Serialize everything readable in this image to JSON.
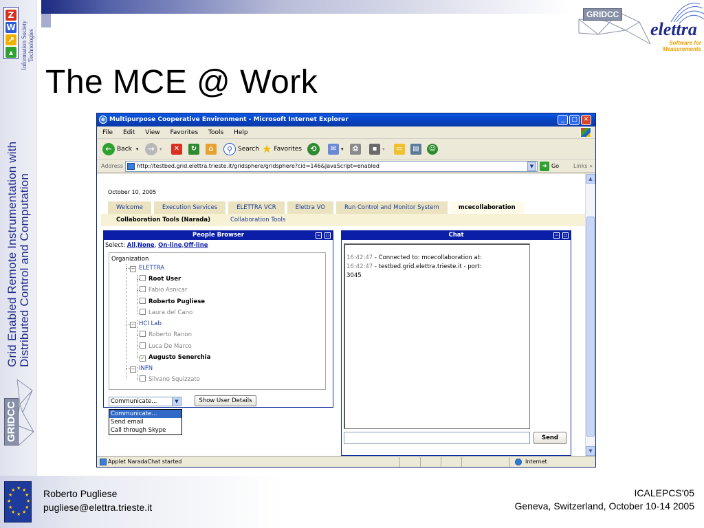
{
  "slide": {
    "title": "The MCE @ Work",
    "vertical_title_line1": "Grid Enabled Remote Instrumentation with",
    "vertical_title_line2": "Distributed Control and Computation",
    "ist_line1": "Information Society",
    "ist_line2": "Technologies",
    "gridcc_label": "GRIDCC",
    "elettra_name": "elettra",
    "elettra_tag_line1": "Software for",
    "elettra_tag_line2": "Measurements",
    "footer_left_line1": "Roberto Pugliese",
    "footer_left_line2": "pugliese@elettra.trieste.it",
    "footer_right_line1": "ICALEPCS'05",
    "footer_right_line2": "Geneva, Switzerland, October 10-14 2005"
  },
  "browser": {
    "window_title": "Multipurpose Cooperative Environment - Microsoft Internet Explorer",
    "menu": [
      "File",
      "Edit",
      "View",
      "Favorites",
      "Tools",
      "Help"
    ],
    "toolbar": {
      "back": "Back",
      "search": "Search",
      "favorites": "Favorites"
    },
    "address_label": "Address",
    "address_url": "http://testbed.grid.elettra.trieste.it/gridsphere/gridsphere?cid=146&JavaScript=enabled",
    "go_label": "Go",
    "links_label": "Links",
    "status_text": "Applet NaradaChat started",
    "zone_text": "Internet"
  },
  "page": {
    "date": "October 10, 2005",
    "tabs": [
      "Welcome",
      "Execution Services",
      "ELETTRA VCR",
      "Elettra VO",
      "Run Control and Monitor System",
      "mcecollaboration"
    ],
    "subtabs": [
      "Collaboration Tools (Narada)",
      "Collaboration Tools"
    ]
  },
  "people_browser": {
    "header": "People Browser",
    "select_label": "Select:",
    "select_all": "All",
    "select_none": "None",
    "select_online": "On-line",
    "select_offline": "Off-line",
    "root": "Organization",
    "groups": [
      {
        "name": "ELETTRA",
        "users": [
          {
            "name": "Root User",
            "online": true,
            "checked": false
          },
          {
            "name": "Fabio Asnicar",
            "online": false,
            "checked": false
          },
          {
            "name": "Roberto Pugliese",
            "online": true,
            "checked": false
          },
          {
            "name": "Laura del Cano",
            "online": false,
            "checked": false
          }
        ]
      },
      {
        "name": "HCI Lab",
        "users": [
          {
            "name": "Roberto Ranon",
            "online": false,
            "checked": false
          },
          {
            "name": "Luca De Marco",
            "online": false,
            "checked": false
          },
          {
            "name": "Augusto Senerchia",
            "online": true,
            "checked": true
          }
        ]
      },
      {
        "name": "INFN",
        "users": [
          {
            "name": "Silvano Squizzato",
            "online": false,
            "checked": false
          }
        ]
      }
    ],
    "communicate_value": "Communicate...",
    "communicate_options": [
      "Communicate...",
      "Send email",
      "Call through Skype"
    ],
    "show_details_label": "Show User Details"
  },
  "chat": {
    "header": "Chat",
    "messages": [
      {
        "time": "16:42:47",
        "text": "- Connected to: mcecollaboration at:"
      },
      {
        "time": "16:42:47",
        "text": "- testbed.grid.elettra.trieste.it - port:"
      },
      {
        "time": "",
        "text": "3045"
      }
    ],
    "send_label": "Send"
  },
  "colors": {
    "panel_header": "#0a1ea8",
    "title_blue": "#1f2a8a",
    "xp_title": "#0845c8"
  }
}
